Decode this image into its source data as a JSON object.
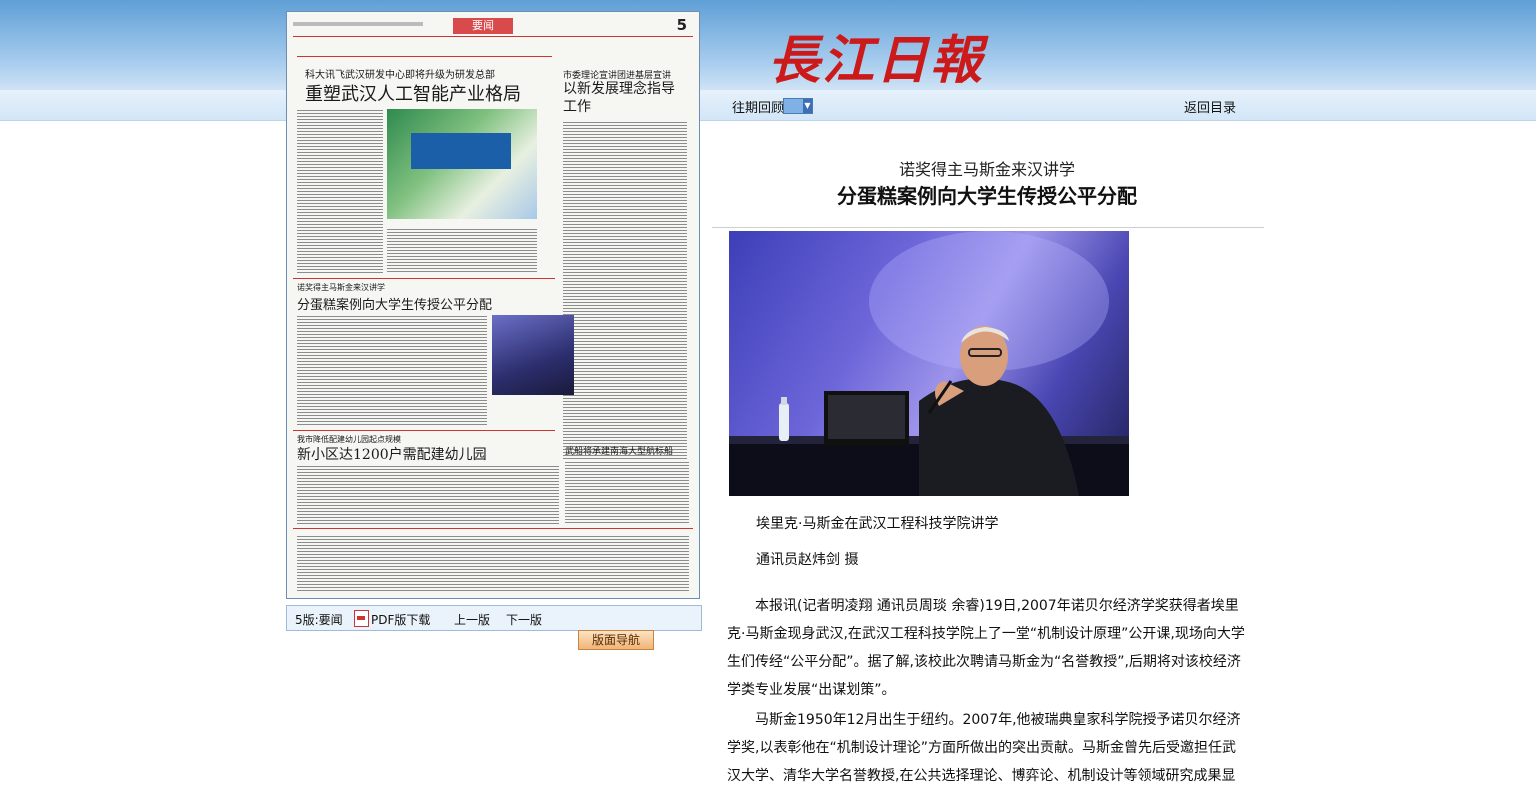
{
  "header": {
    "logo": "長江日報",
    "past_issues": "往期回顾",
    "back_to_index": "返回目录"
  },
  "newspaper_page": {
    "section": "要闻",
    "page_number": "5",
    "story1_kicker": "科大讯飞武汉研发中心即将升级为研发总部",
    "story1_title": "重塑武汉人工智能产业格局",
    "story2_kicker": "市委理论宣讲团进基层宣讲",
    "story2_title": "以新发展理念指导工作",
    "story3_kicker": "诺奖得主马斯金来汉讲学",
    "story3_title": "分蛋糕案例向大学生传授公平分配",
    "story4_kicker": "我市降低配建幼儿园起点规模",
    "story4_title": "新小区达1200户需配建幼儿园",
    "story5_title": "武船将承建南海大型航标船"
  },
  "page_bar": {
    "page_label": "5版:要闻",
    "pdf_label": "PDF版下载",
    "prev": "上一版",
    "next": "下一版"
  },
  "layout_nav_button": "版面导航",
  "article": {
    "subtitle": "诺奖得主马斯金来汉讲学",
    "title": "分蛋糕案例向大学生传授公平分配",
    "photo_caption": "埃里克·马斯金在武汉工程科技学院讲学",
    "photo_credit": "通讯员赵炜剑 摄",
    "paragraph1": "本报讯(记者明凌翔 通讯员周琰 余睿)19日,2007年诺贝尔经济学奖获得者埃里克·马斯金现身武汉,在武汉工程科技学院上了一堂“机制设计原理”公开课,现场向大学生们传经“公平分配”。据了解,该校此次聘请马斯金为“名誉教授”,后期将对该校经济学类专业发展“出谋划策”。",
    "paragraph2": "马斯金1950年12月出生于纽约。2007年,他被瑞典皇家科学院授予诺贝尔经济学奖,以表彰他在“机制设计理论”方面所做出的突出贡献。马斯金曾先后受邀担任武汉大学、清华大学名誉教授,在公共选择理论、博弈论、机制设计等领域研究成果显"
  }
}
